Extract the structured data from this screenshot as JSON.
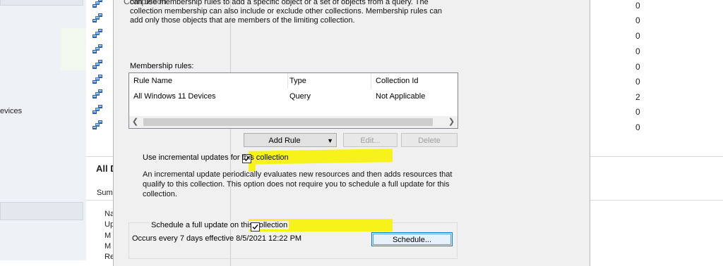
{
  "background": {
    "left_item": "evices",
    "row_counts": [
      "0",
      "0",
      "0",
      "0",
      "0",
      "0",
      "2",
      "0",
      "0"
    ],
    "detail_title": "All D",
    "summary_label": "Sum",
    "summary_items": [
      "Na",
      "Up",
      "M",
      "M",
      "Re"
    ]
  },
  "dialog": {
    "nav": {
      "completion": "Completion"
    },
    "description": "can use membership rules to add a specific object or a set of objects from a query. The collection membership can also include or exclude other collections. Membership rules can add only those objects that are members of the limiting collection.",
    "membership_rules_label": "Membership rules:",
    "rules_table": {
      "headers": [
        "Rule Name",
        "Type",
        "Collection Id"
      ],
      "rows": [
        [
          "All Windows 11 Devices",
          "Query",
          "Not Applicable"
        ]
      ]
    },
    "buttons": {
      "add_rule": "Add Rule",
      "edit": "Edit...",
      "delete": "Delete",
      "schedule": "Schedule..."
    },
    "incremental": {
      "label": "Use incremental updates for this collection",
      "checked": true,
      "description": "An incremental update periodically evaluates new resources and then adds resources that qualify to this collection. This option does not require you to schedule a full update for this collection."
    },
    "full_update": {
      "label": "Schedule a full update on this collection",
      "checked": true,
      "occurs": "Occurs every 7 days effective 8/5/2021 12:22 PM"
    }
  },
  "colors": {
    "highlight": "#f6f21a",
    "focus_border": "#0078d7"
  }
}
